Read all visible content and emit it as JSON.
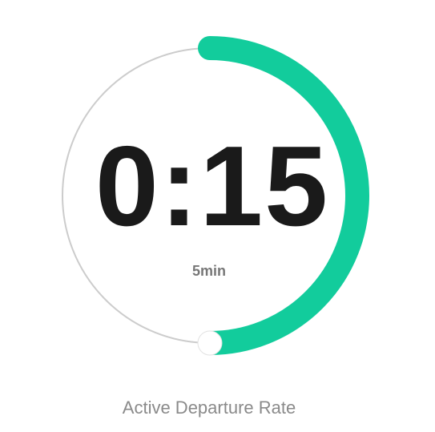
{
  "timer": {
    "time_remaining": "0:15",
    "duration": "5min",
    "progress": 0.5,
    "colors": {
      "progress": "#12CC9C",
      "track": "#CCCCCC",
      "time_text": "#1A1A1A",
      "label_text": "#777777"
    }
  },
  "caption": "Active Departure Rate"
}
